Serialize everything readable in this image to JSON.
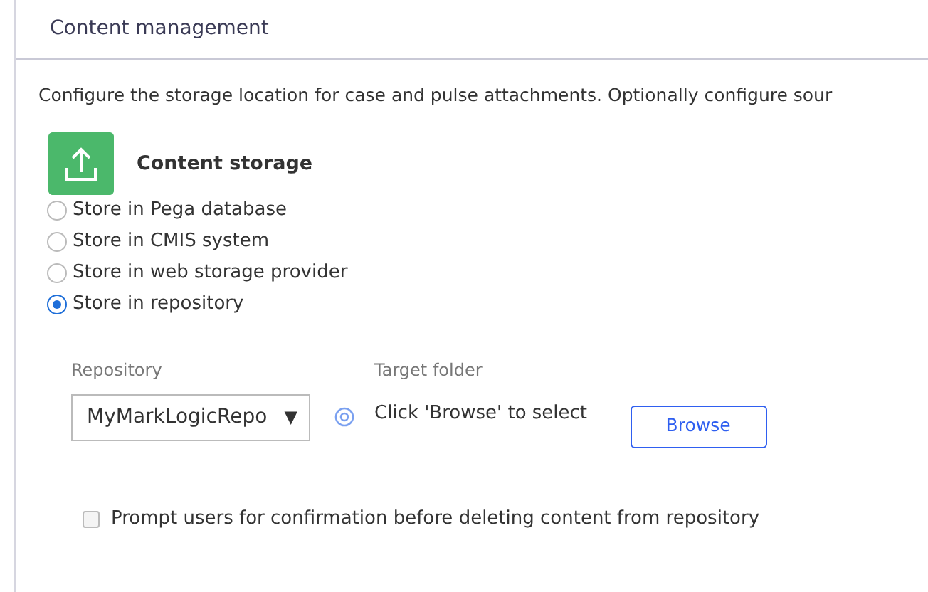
{
  "section": {
    "title": "Content management"
  },
  "description": "Configure the storage location for case and pulse attachments. Optionally configure sour",
  "storage": {
    "title": "Content storage",
    "options": [
      {
        "label": "Store in Pega database",
        "selected": false
      },
      {
        "label": "Store in CMIS system",
        "selected": false
      },
      {
        "label": "Store in web storage provider",
        "selected": false
      },
      {
        "label": "Store in repository",
        "selected": true
      }
    ]
  },
  "repository": {
    "label": "Repository",
    "value": "MyMarkLogicRepo",
    "caret": "▼"
  },
  "target_folder": {
    "label": "Target folder",
    "value": "Click 'Browse' to select",
    "button": "Browse"
  },
  "confirm_delete": {
    "label": "Prompt users for confirmation before deleting content from repository",
    "checked": false
  }
}
